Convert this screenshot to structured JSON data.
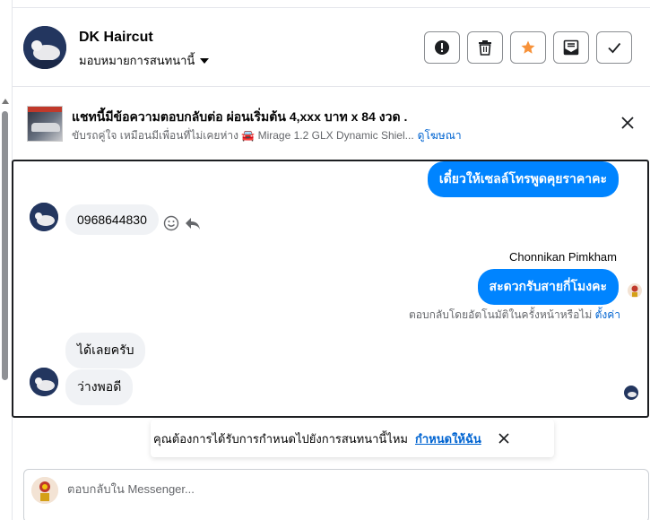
{
  "header": {
    "contact_name": "DK Haircut",
    "assign_label": "มอบหมายการสนทนานี้",
    "actions": [
      "spam-icon",
      "trash-icon",
      "star-icon",
      "mark-unread-icon",
      "check-icon"
    ],
    "star_color": "#f7923a"
  },
  "ad": {
    "title": "แชทนี้มีข้อความตอบกลับต่อ ผ่อนเริ่มต้น 4,xxx บาท x 84 งวด .",
    "description": "ขับรถคู่ใจ เหมือนมีเพื่อนที่ไม่เคยห่าง 🚘 Mirage 1.2 GLX Dynamic Shiel...",
    "link": "ดูโฆษณา"
  },
  "chat": {
    "messages": {
      "out_1": "เดี๋ยวให้เซลล์โทรพูดคุยราคาคะ",
      "in_1": "0968644830",
      "sender_name": "Chonnikan Pimkham",
      "out_2": "สะดวกรับสายกี่โมงคะ",
      "in_2": "ได้เลยครับ",
      "in_3": "ว่างพอดี"
    },
    "auto_reply_note": "ตอบกลับโดยอัตโนมัติในครั้งหน้าหรือไม่",
    "auto_reply_link": "ตั้งค่า",
    "accent_color": "#0084ff"
  },
  "reminder": {
    "text": "คุณต้องการได้รับการกำหนดไปยังการสนทนานี้ไหม",
    "link": "กำหนดให้ฉัน"
  },
  "composer": {
    "placeholder": "ตอบกลับใน Messenger..."
  }
}
